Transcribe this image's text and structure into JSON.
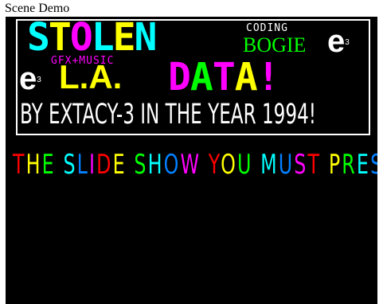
{
  "page": {
    "title": "Scene Demo"
  },
  "banner": {
    "stolen_letters": [
      "S",
      "T",
      "O",
      "L",
      "E",
      "N"
    ],
    "coding_label": "CODING",
    "coder_name": "BOGIE",
    "group_logo_main": "e",
    "group_logo_sup": "3",
    "gfx_label": "GFX+MUSIC",
    "artist_name": "L.A.",
    "data_letters": [
      "D",
      "A",
      "T",
      "A",
      "!"
    ],
    "byline": "BY EXTACY-3 IN THE YEAR 1994!"
  },
  "scroller": {
    "text": "THE SLIDE SHOW YOU MUST PRESS :",
    "colors": [
      "#ff0000",
      "#ffff00",
      "#00ff00",
      "#00ffff",
      "#0080ff",
      "#ff00ff"
    ]
  }
}
